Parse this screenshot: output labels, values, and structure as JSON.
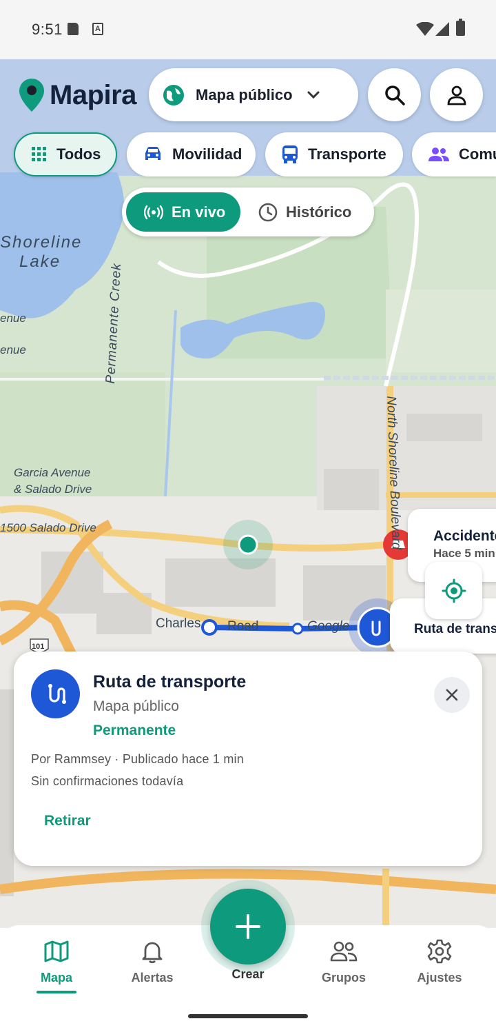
{
  "status_bar": {
    "time": "9:51"
  },
  "header": {
    "brand": "Mapira",
    "map_selector": "Mapa público",
    "icons": [
      "pin-icon",
      "globe-icon",
      "search-icon",
      "account-icon"
    ]
  },
  "filters": [
    {
      "label": "Todos",
      "icon": "grid-icon",
      "active": true
    },
    {
      "label": "Movilidad",
      "icon": "car-icon",
      "active": false
    },
    {
      "label": "Transporte",
      "icon": "bus-icon",
      "active": false
    },
    {
      "label": "Comu",
      "icon": "group-icon",
      "active": false
    }
  ],
  "mode_toggle": {
    "live": "En vivo",
    "history": "Histórico",
    "selected": "En vivo"
  },
  "map_labels": {
    "lake": "Shoreline",
    "lake2": "Lake",
    "enue1": "enue",
    "enue2": "enue",
    "creek": "Permanente Creek",
    "blvd": "North Shoreline Boulevard",
    "stop1": "Garcia Avenue",
    "stop2": "& Salado Drive",
    "addr": "1500 Salado Drive",
    "road1": "Charles",
    "road2": "Road",
    "road3": "Google",
    "hw": "101"
  },
  "overlays": {
    "accident_title": "Accidente",
    "accident_time": "Hace 5 min",
    "route_mini": "Ruta de transporte"
  },
  "detail_card": {
    "title": "Ruta de transporte",
    "map": "Mapa público",
    "duration": "Permanente",
    "meta": "Por Rammsey · Publicado hace 1 min",
    "confirmations": "Sin confirmaciones todavía",
    "action": "Retirar"
  },
  "bottom_nav": {
    "items": [
      {
        "label": "Mapa",
        "icon": "map-icon",
        "active": true
      },
      {
        "label": "Alertas",
        "icon": "bell-icon",
        "active": false
      },
      {
        "label": "Crear",
        "icon": "plus-icon",
        "active": false
      },
      {
        "label": "Grupos",
        "icon": "group-icon",
        "active": false
      },
      {
        "label": "Ajustes",
        "icon": "gear-icon",
        "active": false
      }
    ]
  },
  "colors": {
    "accent": "#0e9a7c",
    "route_blue": "#1f58d6",
    "accident_red": "#e53935"
  }
}
